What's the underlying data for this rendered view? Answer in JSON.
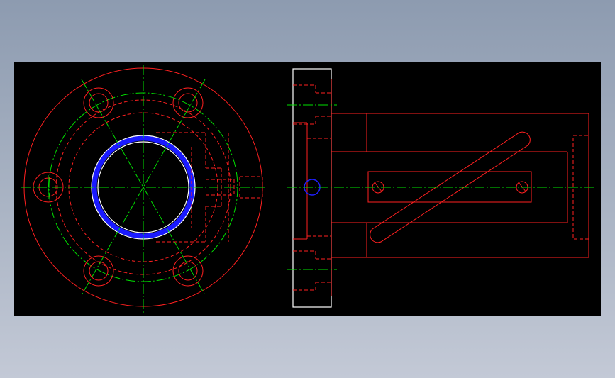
{
  "colors": {
    "background_top": "#8d9bb0",
    "background_bottom": "#c3c9d6",
    "canvas": "#000000",
    "outline": "#ff2020",
    "centerline": "#00e000",
    "bore_highlight": "#2020ff",
    "bore_edge": "#ffffff"
  },
  "views": {
    "front": "flange-front-view",
    "side": "flange-side-view"
  }
}
